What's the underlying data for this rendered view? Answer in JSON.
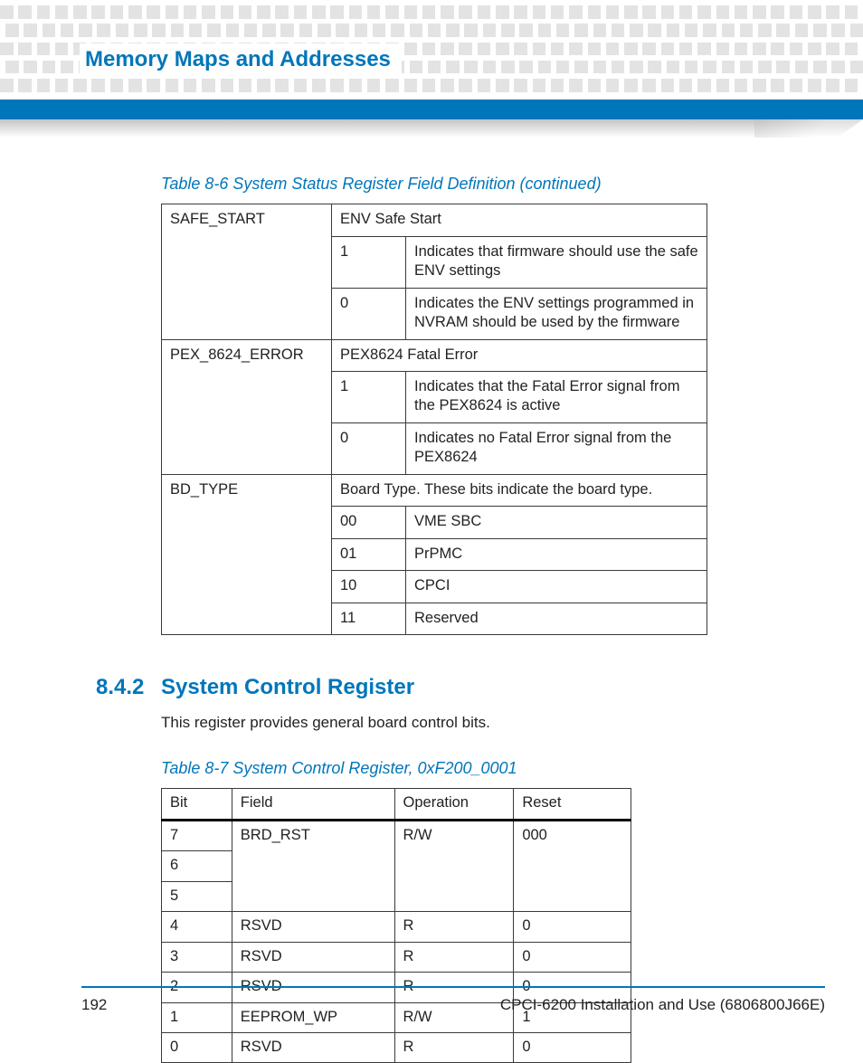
{
  "chapterTitle": "Memory Maps and Addresses",
  "table86": {
    "caption": "Table 8-6 System Status Register Field Definition (continued)",
    "rows": [
      {
        "name": "SAFE_START",
        "heading": "ENV Safe Start",
        "items": [
          {
            "val": "1",
            "desc": "Indicates that firmware should use the safe ENV settings"
          },
          {
            "val": "0",
            "desc": "Indicates the ENV settings programmed in NVRAM should be used by the firmware"
          }
        ]
      },
      {
        "name": "PEX_8624_ERROR",
        "heading": "PEX8624 Fatal Error",
        "items": [
          {
            "val": "1",
            "desc": "Indicates that the Fatal Error signal from the PEX8624 is active"
          },
          {
            "val": "0",
            "desc": "Indicates no Fatal Error signal from the PEX8624"
          }
        ]
      },
      {
        "name": "BD_TYPE",
        "heading": "Board Type.  These bits indicate the board type.",
        "items": [
          {
            "val": "00",
            "desc": "VME SBC"
          },
          {
            "val": "01",
            "desc": "PrPMC"
          },
          {
            "val": "10",
            "desc": "CPCI"
          },
          {
            "val": "11",
            "desc": "Reserved"
          }
        ]
      }
    ]
  },
  "section": {
    "number": "8.4.2",
    "title": "System Control Register",
    "para": "This register provides general board control bits."
  },
  "table87": {
    "caption": "Table 8-7 System Control Register, 0xF200_0001",
    "headers": {
      "bit": "Bit",
      "field": "Field",
      "op": "Operation",
      "reset": "Reset"
    },
    "rows": [
      {
        "bit": "7",
        "field": "BRD_RST",
        "op": "R/W",
        "reset": "000",
        "span": 3
      },
      {
        "bit": "6"
      },
      {
        "bit": "5"
      },
      {
        "bit": "4",
        "field": "RSVD",
        "op": "R",
        "reset": "0"
      },
      {
        "bit": "3",
        "field": "RSVD",
        "op": "R",
        "reset": "0"
      },
      {
        "bit": "2",
        "field": "RSVD",
        "op": "R",
        "reset": "0"
      },
      {
        "bit": "1",
        "field": "EEPROM_WP",
        "op": "R/W",
        "reset": "1"
      },
      {
        "bit": "0",
        "field": "RSVD",
        "op": "R",
        "reset": "0"
      }
    ]
  },
  "footer": {
    "pageNum": "192",
    "docId": "CPCI-6200 Installation and Use (6806800J66E)"
  }
}
